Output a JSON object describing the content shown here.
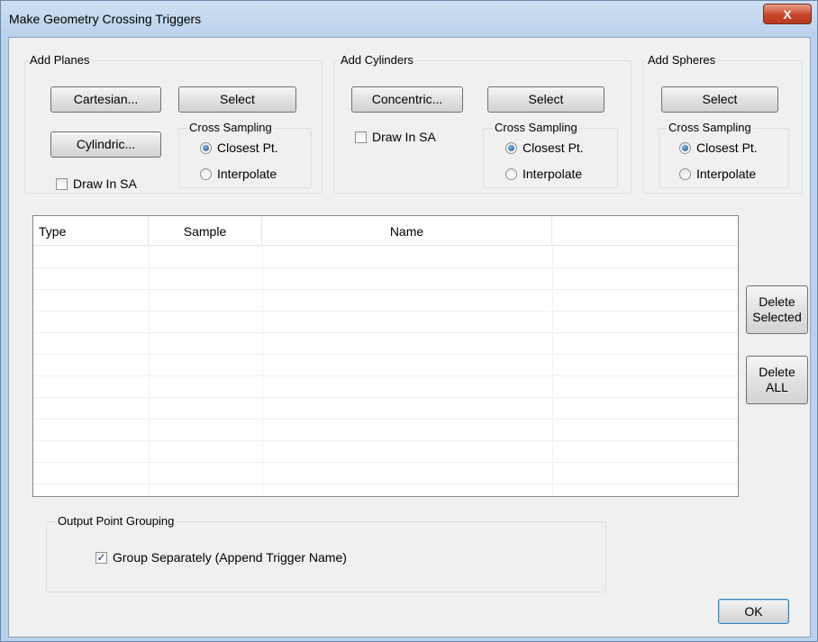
{
  "window": {
    "title": "Make Geometry Crossing Triggers",
    "close_glyph": "X"
  },
  "add_planes": {
    "label": "Add Planes",
    "cartesian_label": "Cartesian...",
    "select_label": "Select",
    "cylindric_label": "Cylindric...",
    "draw_in_sa_label": "Draw In SA",
    "draw_in_sa_checked": false,
    "cross_sampling": {
      "label": "Cross Sampling",
      "closest_label": "Closest Pt.",
      "interpolate_label": "Interpolate",
      "selected": "closest"
    }
  },
  "add_cylinders": {
    "label": "Add Cylinders",
    "concentric_label": "Concentric...",
    "select_label": "Select",
    "draw_in_sa_label": "Draw In SA",
    "draw_in_sa_checked": false,
    "cross_sampling": {
      "label": "Cross Sampling",
      "closest_label": "Closest Pt.",
      "interpolate_label": "Interpolate",
      "selected": "closest"
    }
  },
  "add_spheres": {
    "label": "Add Spheres",
    "select_label": "Select",
    "cross_sampling": {
      "label": "Cross Sampling",
      "closest_label": "Closest Pt.",
      "interpolate_label": "Interpolate",
      "selected": "closest"
    }
  },
  "table": {
    "columns": [
      "Type",
      "Sample",
      "Name",
      ""
    ],
    "rows": []
  },
  "side_buttons": {
    "delete_selected_label": "Delete\nSelected",
    "delete_all_label": "Delete\nALL"
  },
  "output_grouping": {
    "label": "Output Point Grouping",
    "group_separately_label": "Group Separately (Append Trigger Name)",
    "group_separately_checked": true
  },
  "footer": {
    "ok_label": "OK"
  },
  "colors": {
    "title_bar": "#b9d1ea",
    "close_button": "#c9452a",
    "dialog_bg": "#f0f0f0",
    "radio_selected": "#1a4f8a"
  }
}
